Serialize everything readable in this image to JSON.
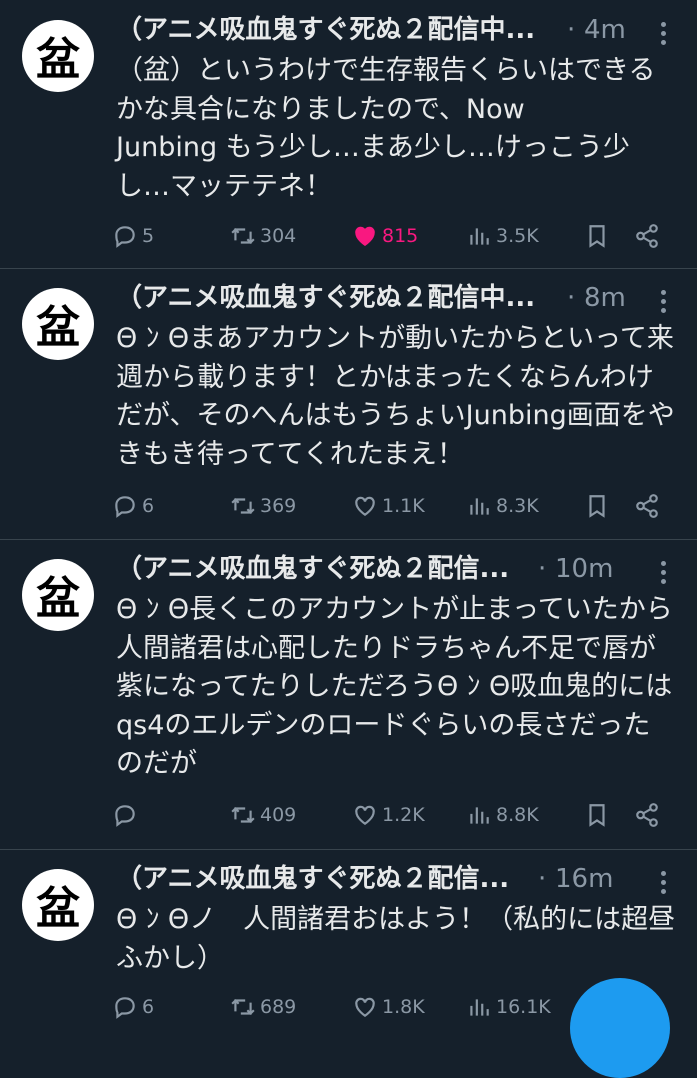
{
  "tweets": [
    {
      "name": "（アニメ吸血鬼すぐ死ぬ２配信中...",
      "time": "4m",
      "text": "（盆）というわけで生存報告くらいはできるかな具合になりましたので、Now\nJunbing もう少し…まあ少し…けっこう少し…マッテテネ！",
      "replies": "5",
      "retweets": "304",
      "likes": "815",
      "views": "3.5K",
      "liked": true
    },
    {
      "name": "（アニメ吸血鬼すぐ死ぬ２配信中...",
      "time": "8m",
      "text": "Θ ﾝ Θまあアカウントが動いたからといって来週から載ります！とかはまったくならんわけだが、そのへんはもうちょいJunbing画面をやきもき待っててくれたまえ！",
      "replies": "6",
      "retweets": "369",
      "likes": "1.1K",
      "views": "8.3K",
      "liked": false
    },
    {
      "name": "（アニメ吸血鬼すぐ死ぬ２配信...",
      "time": "10m",
      "text": "Θ ﾝ Θ長くこのアカウントが止まっていたから人間諸君は心配したりドラちゃん不足で唇が紫になってたりしただろうΘ ﾝ Θ吸血鬼的にはqs4のエルデンのロードぐらいの長さだったのだが",
      "replies": "",
      "retweets": "409",
      "likes": "1.2K",
      "views": "8.8K",
      "liked": false
    },
    {
      "name": "（アニメ吸血鬼すぐ死ぬ２配信...",
      "time": "16m",
      "text": "Θ ﾝ Θノ　人間諸君おはよう！（私的には超昼ふかし）",
      "replies": "6",
      "retweets": "689",
      "likes": "1.8K",
      "views": "16.1K",
      "liked": false
    }
  ],
  "avatar_glyph": "盆",
  "colors": {
    "background": "#15202b",
    "muted": "#8b98a5",
    "like": "#f91880",
    "accent": "#1d9bf0"
  },
  "icons": [
    "reply-icon",
    "retweet-icon",
    "like-icon",
    "views-icon",
    "bookmark-icon",
    "share-icon",
    "more-icon"
  ]
}
